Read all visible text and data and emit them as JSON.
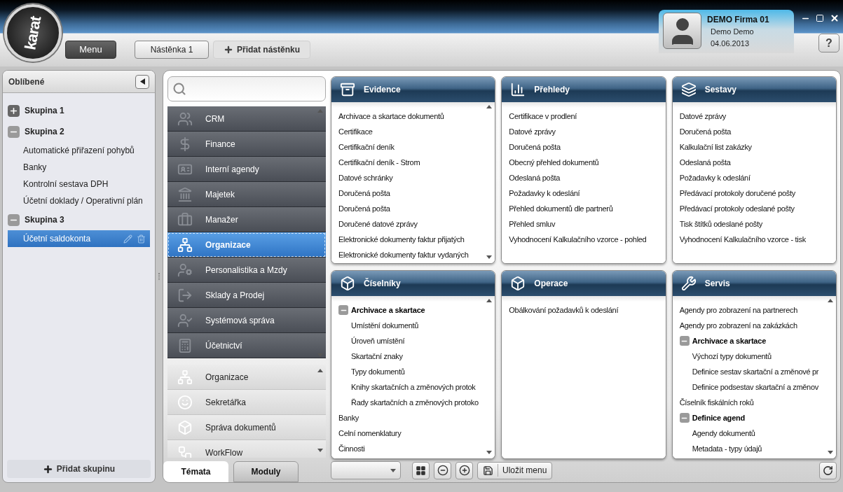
{
  "logo": {
    "text": "karat"
  },
  "header": {
    "menu_button": "Menu",
    "boards": [
      {
        "label": "Nástěnka 1",
        "selected": true
      }
    ],
    "add_board": "Přidat nástěnku"
  },
  "user": {
    "company": "DEMO Firma 01",
    "name": "Demo Demo",
    "date": "04.06.2013"
  },
  "help_button": "?",
  "favorites": {
    "title": "Oblíbené",
    "groups": [
      {
        "label": "Skupina 1",
        "expanded": false
      },
      {
        "label": "Skupina 2",
        "expanded": true,
        "children": [
          {
            "label": "Automatické přiřazení pohybů",
            "selected": false
          },
          {
            "label": "Banky",
            "selected": false
          },
          {
            "label": "Kontrolní sestava DPH",
            "selected": false
          },
          {
            "label": "Účetní doklady / Operativní plán",
            "selected": false
          }
        ]
      },
      {
        "label": "Skupina 3",
        "expanded": true,
        "children": [
          {
            "label": "Účetní saldokonta",
            "selected": true
          }
        ]
      }
    ],
    "add_group": "Přidat skupinu"
  },
  "categories": [
    {
      "label": "CRM",
      "selected": false
    },
    {
      "label": "Finance",
      "selected": false
    },
    {
      "label": "Interní agendy",
      "selected": false
    },
    {
      "label": "Majetek",
      "selected": false
    },
    {
      "label": "Manažer",
      "selected": false
    },
    {
      "label": "Organizace",
      "selected": true
    },
    {
      "label": "Personalistika a Mzdy",
      "selected": false
    },
    {
      "label": "Sklady a Prodej",
      "selected": false
    },
    {
      "label": "Systémová správa",
      "selected": false
    },
    {
      "label": "Účetnictví",
      "selected": false
    }
  ],
  "modules": [
    {
      "label": "Organizace"
    },
    {
      "label": "Sekretářka"
    },
    {
      "label": "Správa dokumentů"
    },
    {
      "label": "WorkFlow"
    }
  ],
  "tabs": [
    {
      "label": "Témata",
      "selected": true
    },
    {
      "label": "Moduly",
      "selected": false
    }
  ],
  "cards": [
    {
      "title": "Evidence",
      "items": [
        {
          "label": "Archivace a skartace dokumentů"
        },
        {
          "label": "Certifikace"
        },
        {
          "label": "Certifikační deník"
        },
        {
          "label": "Certifikační deník - Strom"
        },
        {
          "label": "Datové schránky"
        },
        {
          "label": "Doručená pošta"
        },
        {
          "label": "Doručená pošta"
        },
        {
          "label": "Doručené datové zprávy"
        },
        {
          "label": "Elektronické dokumenty faktur přijatých"
        },
        {
          "label": "Elektronické dokumenty faktur vydaných"
        }
      ]
    },
    {
      "title": "Přehledy",
      "items": [
        {
          "label": "Certifikace v prodlení"
        },
        {
          "label": "Datové zprávy"
        },
        {
          "label": "Doručená pošta"
        },
        {
          "label": "Obecný přehled dokumentů"
        },
        {
          "label": "Odeslaná pošta"
        },
        {
          "label": "Požadavky k odeslání"
        },
        {
          "label": "Přehled dokumentů dle partnerů"
        },
        {
          "label": "Přehled smluv"
        },
        {
          "label": "Vyhodnocení Kalkulačního vzorce - pohled"
        }
      ]
    },
    {
      "title": "Sestavy",
      "items": [
        {
          "label": "Datové zprávy"
        },
        {
          "label": "Doručená pošta"
        },
        {
          "label": "Kalkulační list zakázky"
        },
        {
          "label": "Odeslaná pošta"
        },
        {
          "label": "Požadavky k odeslání"
        },
        {
          "label": "Předávací protokoly doručené pošty"
        },
        {
          "label": "Předávací protokoly odeslané pošty"
        },
        {
          "label": "Tisk štítků odeslané pošty"
        },
        {
          "label": "Vyhodnocení Kalkulačního vzorce - tisk"
        }
      ]
    },
    {
      "title": "Číselníky",
      "items": [
        {
          "label": "Archivace a skartace",
          "expanded": true,
          "children": [
            {
              "label": "Umístění dokumentů"
            },
            {
              "label": "Úroveň umístění"
            },
            {
              "label": "Skartační znaky"
            },
            {
              "label": "Typy dokumentů"
            },
            {
              "label": "Knihy skartačních a změnových protok"
            },
            {
              "label": "Řady skartačních a změnových protoko"
            }
          ]
        },
        {
          "label": "Banky"
        },
        {
          "label": "Celní nomenklatury"
        },
        {
          "label": "Činnosti"
        }
      ]
    },
    {
      "title": "Operace",
      "items": [
        {
          "label": "Obálkování požadavků k odeslání"
        }
      ]
    },
    {
      "title": "Servis",
      "items": [
        {
          "label": "Agendy pro zobrazení na partnerech"
        },
        {
          "label": "Agendy pro zobrazení na zakázkách"
        },
        {
          "label": "Archivace a skartace",
          "expanded": true,
          "children": [
            {
              "label": "Výchozí typy dokumentů"
            },
            {
              "label": "Definice sestav skartační a změnové pr"
            },
            {
              "label": "Definice podsestav skartační a změnov"
            }
          ]
        },
        {
          "label": "Číselník fiskálních roků"
        },
        {
          "label": "Definice agend",
          "expanded": true,
          "children": [
            {
              "label": "Agendy dokumentů"
            },
            {
              "label": "Metadata - typy údajů"
            }
          ]
        }
      ]
    }
  ],
  "toolbar": {
    "save_button": "Uložit menu"
  }
}
